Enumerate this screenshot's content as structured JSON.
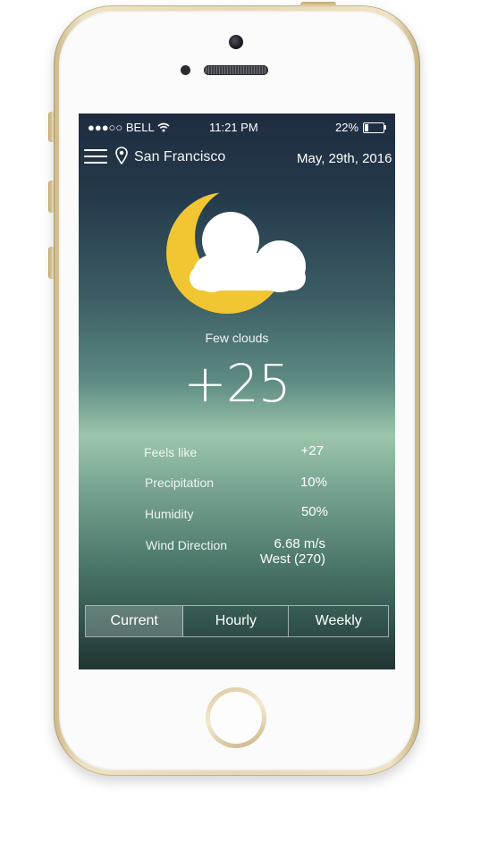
{
  "status_bar": {
    "carrier": "●●●○○ BELL",
    "time": "11:21 PM",
    "battery": "22%"
  },
  "header": {
    "location": "San Francisco",
    "date": "May, 29th, 2016",
    "menu_icon": "hamburger-menu-icon",
    "location_icon": "map-pin-icon"
  },
  "weather": {
    "icon": "moon-cloud-star-icon",
    "condition": "Few clouds",
    "temperature": "+25"
  },
  "details": [
    {
      "label": "Feels like",
      "value": "+27"
    },
    {
      "label": "Precipitation",
      "value": "10%"
    },
    {
      "label": "Humidity",
      "value": "50%"
    },
    {
      "label": "Wind Direction",
      "value": "6.68 m/s",
      "value2": "West (270)"
    }
  ],
  "tabs": [
    {
      "label": "Current",
      "active": true
    },
    {
      "label": "Hourly",
      "active": false
    },
    {
      "label": "Weekly",
      "active": false
    }
  ],
  "colors": {
    "moon": "#f2c533",
    "cloud": "#ffffff",
    "device_frame": "#e6d8b5"
  }
}
